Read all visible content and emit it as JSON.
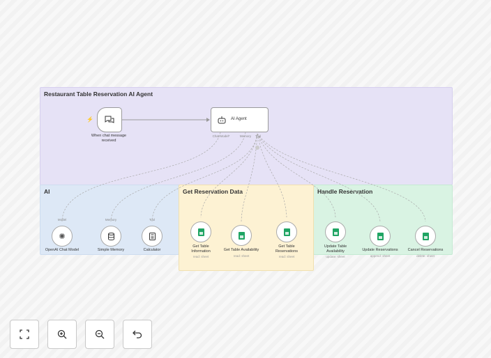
{
  "groups": {
    "agent": {
      "title": "Restaurant Table Reservation AI Agent",
      "color": "#e6e2f6"
    },
    "ai": {
      "title": "AI",
      "color": "#dde8f6"
    },
    "get": {
      "title": "Get Reservation Data",
      "color": "#fdf2d3"
    },
    "handle": {
      "title": "Handle Reservation",
      "color": "#d9f3e3"
    }
  },
  "trigger": {
    "label": "When chat message received",
    "icon": "chat-bubbles-icon"
  },
  "agent": {
    "label": "AI Agent",
    "icon": "robot-icon",
    "ports": {
      "model": "Chat Model*",
      "memory": "Memory",
      "tool": "Tool"
    }
  },
  "ai_nodes": [
    {
      "label": "OpenAI Chat Model",
      "port": "Model",
      "icon": "openai-icon"
    },
    {
      "label": "Simple Memory",
      "port": "Memory",
      "icon": "database-icon"
    },
    {
      "label": "Calculator",
      "port": "Tool",
      "icon": "calculator-icon"
    }
  ],
  "sheet_nodes": [
    {
      "label": "Get Table Information",
      "sub": "read: sheet"
    },
    {
      "label": "Get Table Availability",
      "sub": "read: sheet"
    },
    {
      "label": "Get Table Reservations",
      "sub": "read: sheet"
    },
    {
      "label": "Update Table Availability",
      "sub": "update: sheet"
    },
    {
      "label": "Update Reservations",
      "sub": "append: sheet"
    },
    {
      "label": "Cancel Reservations",
      "sub": "delete: sheet"
    }
  ],
  "controls": [
    "fit-view",
    "zoom-in",
    "zoom-out",
    "undo"
  ]
}
